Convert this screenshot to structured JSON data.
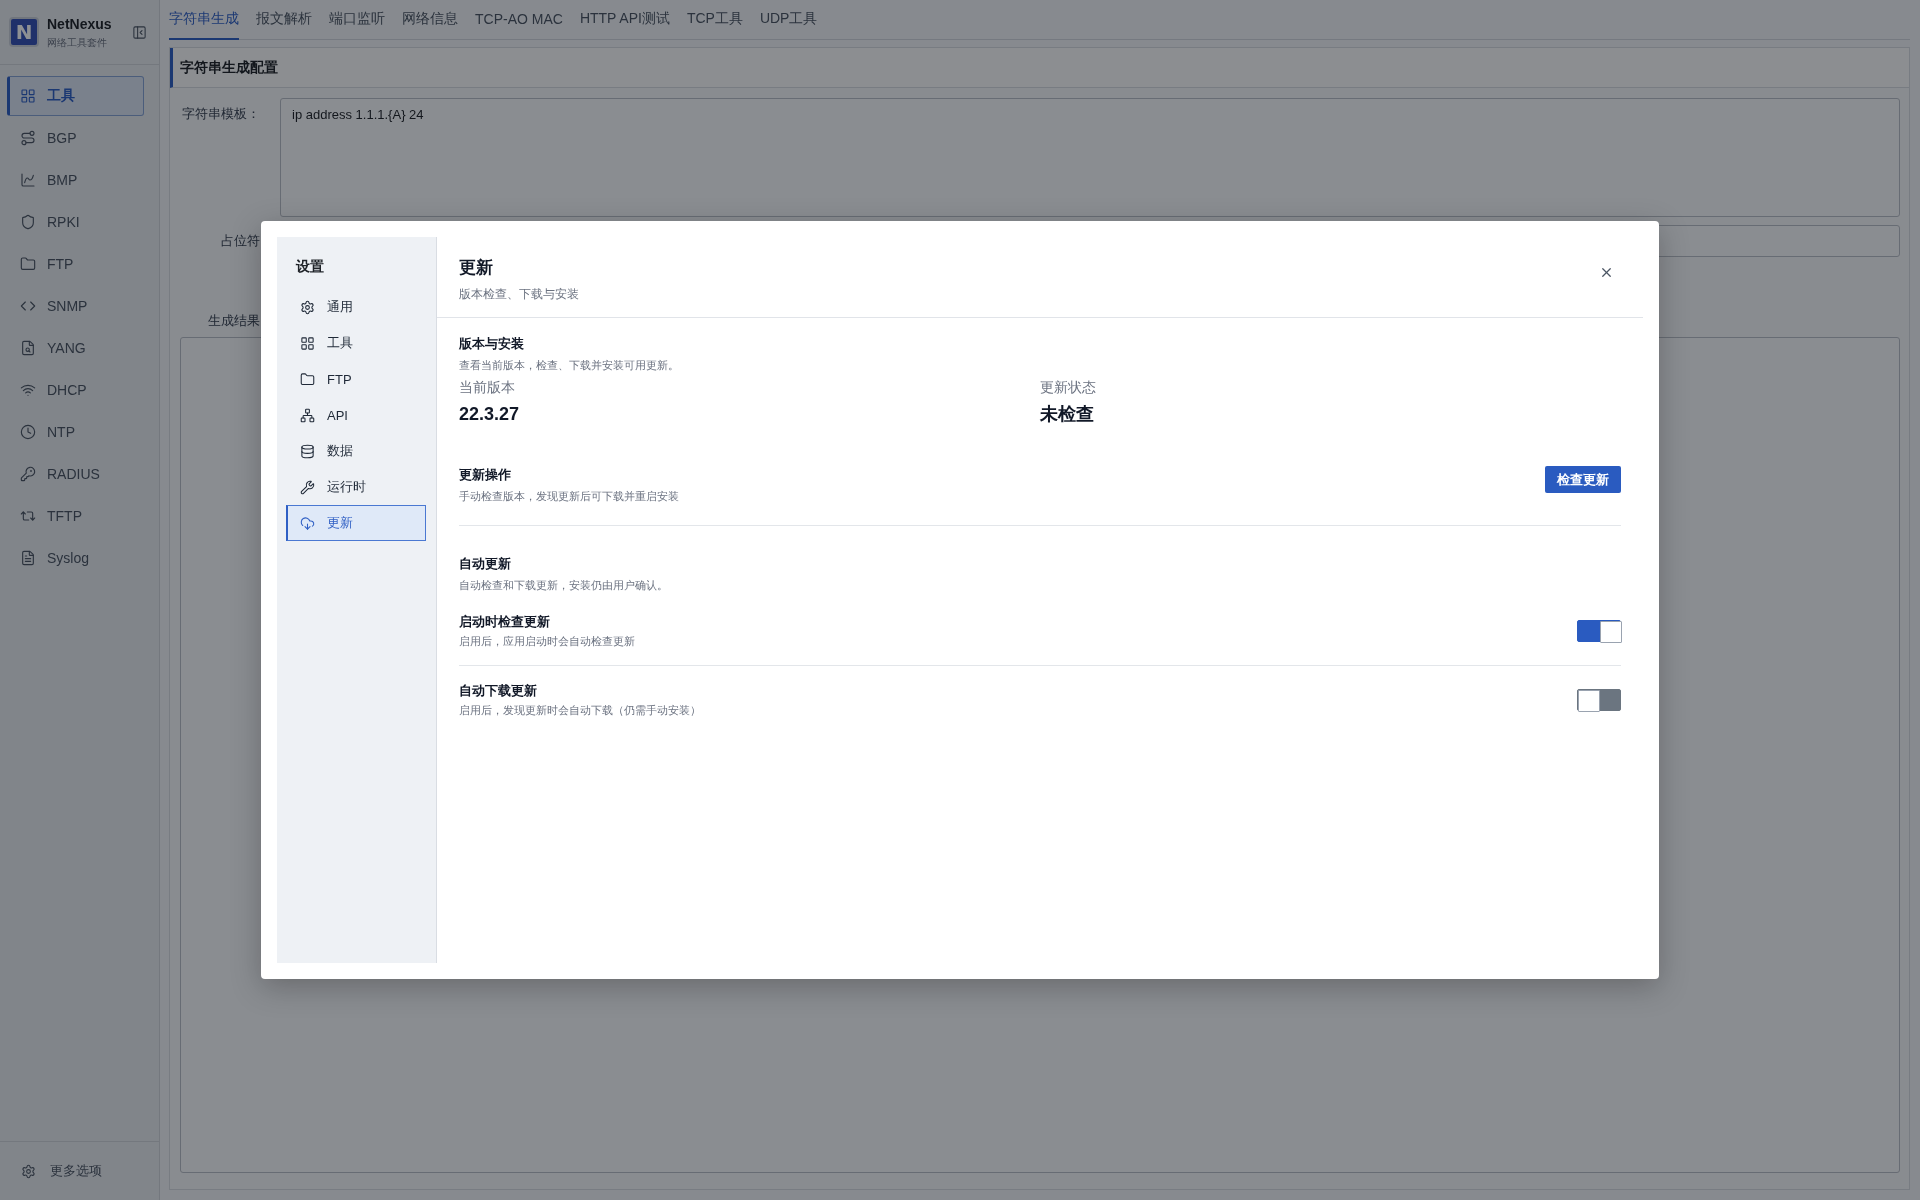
{
  "app": {
    "logo_mark": "N",
    "name": "NetNexus",
    "subtitle": "网络工具套件"
  },
  "sidebar": {
    "items": [
      {
        "label": "工具",
        "selected": true
      },
      {
        "label": "BGP",
        "selected": false
      },
      {
        "label": "BMP",
        "selected": false
      },
      {
        "label": "RPKI",
        "selected": false
      },
      {
        "label": "FTP",
        "selected": false
      },
      {
        "label": "SNMP",
        "selected": false
      },
      {
        "label": "YANG",
        "selected": false
      },
      {
        "label": "DHCP",
        "selected": false
      },
      {
        "label": "NTP",
        "selected": false
      },
      {
        "label": "RADIUS",
        "selected": false
      },
      {
        "label": "TFTP",
        "selected": false
      },
      {
        "label": "Syslog",
        "selected": false
      }
    ],
    "footer": {
      "label": "更多选项"
    }
  },
  "tabs": [
    {
      "label": "字符串生成",
      "selected": true
    },
    {
      "label": "报文解析",
      "selected": false
    },
    {
      "label": "端口监听",
      "selected": false
    },
    {
      "label": "网络信息",
      "selected": false
    },
    {
      "label": "TCP-AO MAC",
      "selected": false
    },
    {
      "label": "HTTP API测试",
      "selected": false
    },
    {
      "label": "TCP工具",
      "selected": false
    },
    {
      "label": "UDP工具",
      "selected": false
    }
  ],
  "config_card": {
    "title": "字符串生成配置",
    "fields": [
      {
        "kind": "textarea",
        "label": "字符串模板：",
        "value": "ip address 1.1.1.{A} 24"
      },
      {
        "kind": "input",
        "label": "占位符"
      },
      {
        "kind": "output",
        "label": "生成结果"
      }
    ]
  },
  "settings_dialog": {
    "nav_title": "设置",
    "nav": [
      {
        "label": "通用",
        "selected": false
      },
      {
        "label": "工具",
        "selected": false
      },
      {
        "label": "FTP",
        "selected": false
      },
      {
        "label": "API",
        "selected": false
      },
      {
        "label": "数据",
        "selected": false
      },
      {
        "label": "运行时",
        "selected": false
      },
      {
        "label": "更新",
        "selected": true
      }
    ],
    "title": "更新",
    "subtitle": "版本检查、下载与安装",
    "sections": [
      {
        "kind": "stats",
        "title": "版本与安装",
        "description": "查看当前版本，检查、下载并安装可用更新。",
        "stats": [
          {
            "label": "当前版本",
            "value": "22.3.27"
          },
          {
            "label": "更新状态",
            "value": "未检查"
          }
        ]
      },
      {
        "kind": "action",
        "title": "更新操作",
        "description": "手动检查版本，发现更新后可下载并重启安装",
        "button": "检查更新"
      },
      {
        "kind": "toggles",
        "title": "自动更新",
        "description": "自动检查和下载更新，安装仍由用户确认。",
        "settings": [
          {
            "title": "启动时检查更新",
            "description": "启用后，应用启动时会自动检查更新",
            "on": true
          },
          {
            "title": "自动下载更新",
            "description": "启用后，发现更新时会自动下载（仍需手动安装）",
            "on": false
          }
        ]
      }
    ]
  }
}
